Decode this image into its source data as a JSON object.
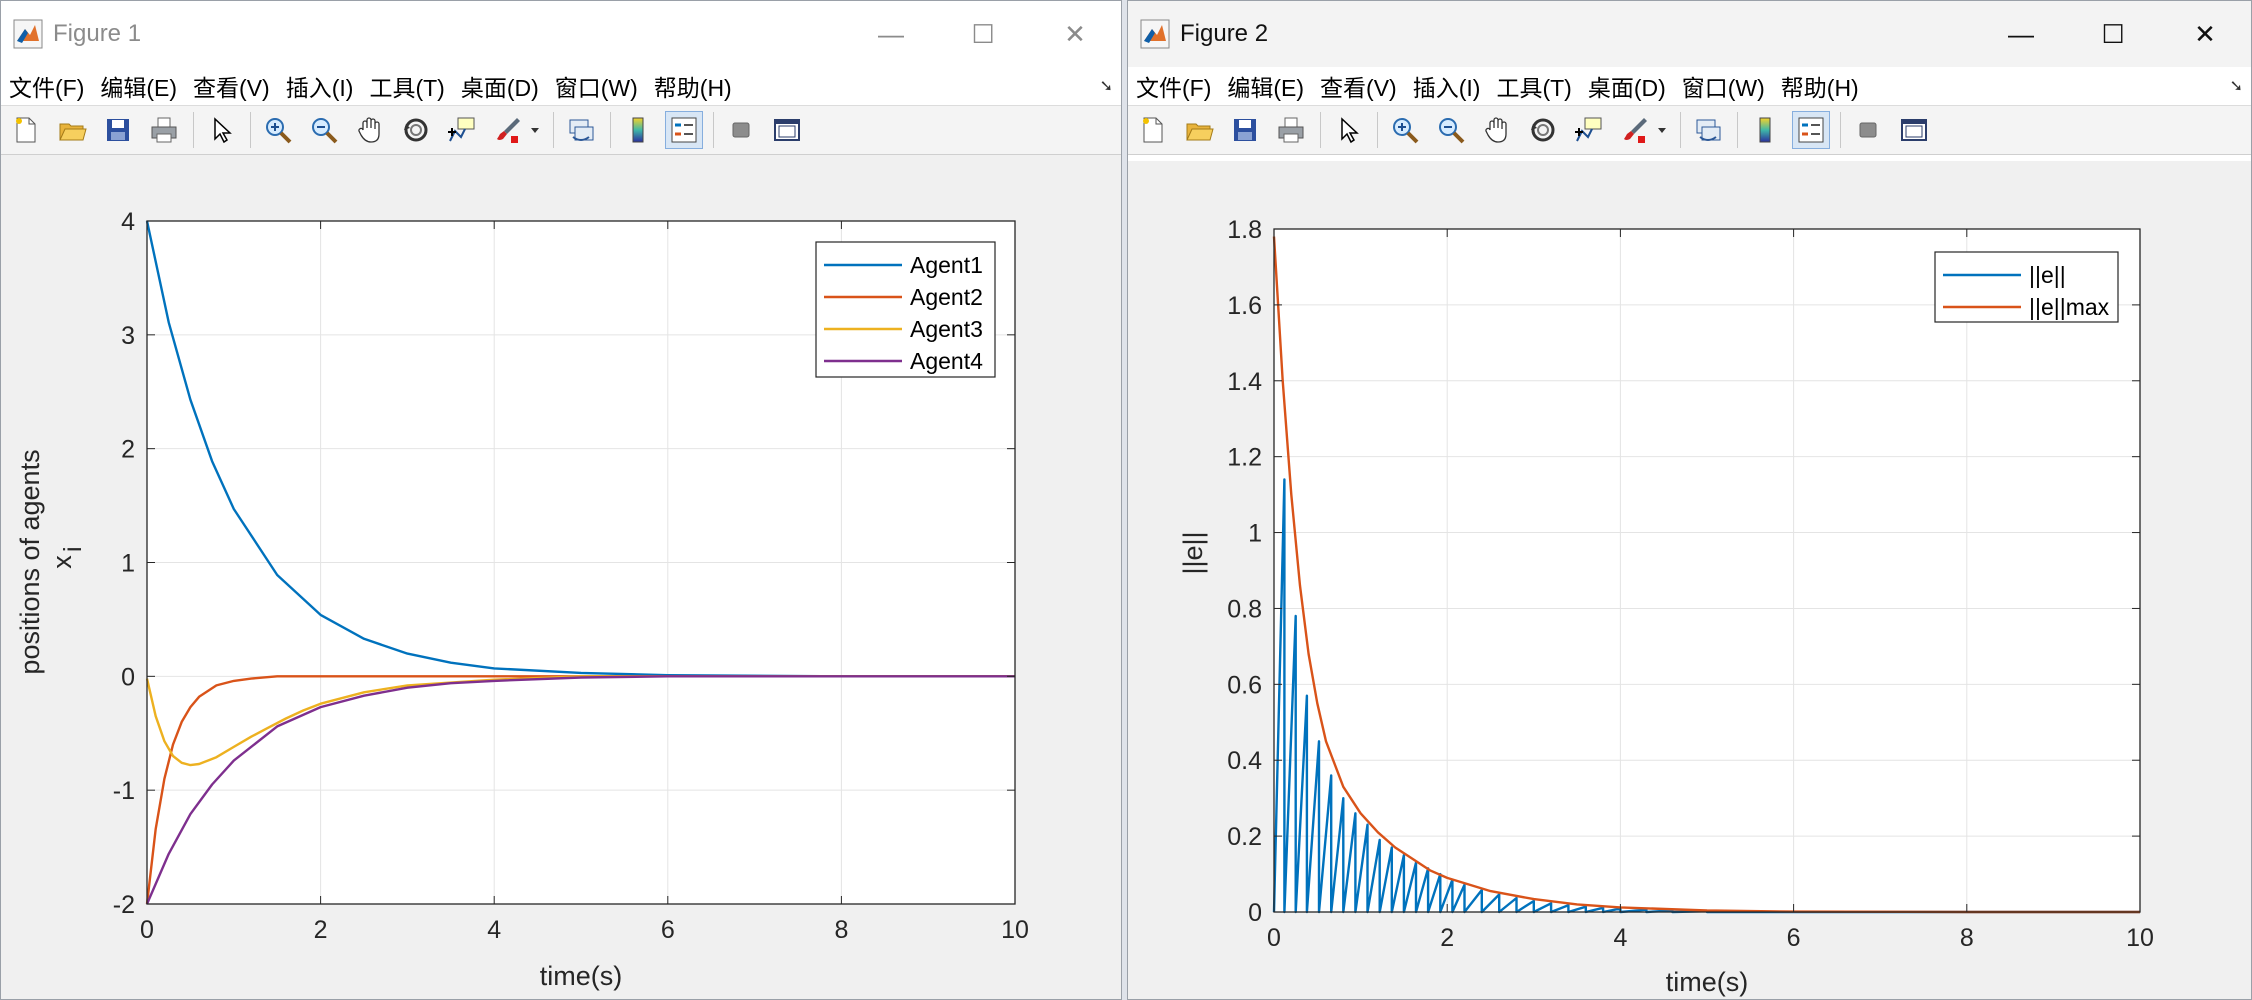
{
  "menus": [
    "文件(F)",
    "编辑(E)",
    "查看(V)",
    "插入(I)",
    "工具(T)",
    "桌面(D)",
    "窗口(W)",
    "帮助(H)"
  ],
  "window_controls": {
    "minimize": "—",
    "maximize": "☐",
    "close": "✕"
  },
  "toolbar_icons": [
    "new-figure-icon",
    "open-file-icon",
    "save-icon",
    "print-icon",
    "edit-plot-icon",
    "zoom-in-icon",
    "zoom-out-icon",
    "pan-icon",
    "rotate-3d-icon",
    "data-cursor-icon",
    "brush-icon",
    "link-plot-icon",
    "insert-colorbar-icon",
    "insert-legend-icon",
    "hide-plot-tools-icon",
    "show-plot-tools-icon"
  ],
  "figure1": {
    "title": "Figure 1",
    "chart_data": {
      "type": "line",
      "xlabel": "time(s)",
      "ylabel_line1": "positions of agents",
      "ylabel_line2": "x",
      "ylabel_sub": "i",
      "xlim": [
        0,
        10
      ],
      "ylim": [
        -2,
        4
      ],
      "xticks": [
        0,
        2,
        4,
        6,
        8,
        10
      ],
      "yticks": [
        -2,
        -1,
        0,
        1,
        2,
        3,
        4
      ],
      "grid": true,
      "legend_position": "top-right",
      "series": [
        {
          "name": "Agent1",
          "color": "#0072BD",
          "x": [
            0,
            0.25,
            0.5,
            0.75,
            1,
            1.5,
            2,
            2.5,
            3,
            3.5,
            4,
            5,
            6,
            8,
            10
          ],
          "y": [
            4,
            3.11,
            2.43,
            1.89,
            1.47,
            0.89,
            0.54,
            0.33,
            0.2,
            0.12,
            0.07,
            0.03,
            0.01,
            0,
            0
          ]
        },
        {
          "name": "Agent2",
          "color": "#D95319",
          "x": [
            0,
            0.1,
            0.2,
            0.3,
            0.4,
            0.5,
            0.6,
            0.8,
            1.0,
            1.2,
            1.5,
            2,
            10
          ],
          "y": [
            -2,
            -1.34,
            -0.9,
            -0.6,
            -0.4,
            -0.27,
            -0.18,
            -0.08,
            -0.04,
            -0.02,
            0,
            0,
            0
          ]
        },
        {
          "name": "Agent3",
          "color": "#EDB120",
          "x": [
            0,
            0.1,
            0.2,
            0.3,
            0.4,
            0.5,
            0.6,
            0.7,
            0.8,
            1.0,
            1.2,
            1.4,
            1.6,
            1.8,
            2.0,
            2.5,
            3,
            4,
            5,
            6,
            10
          ],
          "y": [
            -0.02,
            -0.35,
            -0.57,
            -0.7,
            -0.76,
            -0.78,
            -0.77,
            -0.74,
            -0.71,
            -0.62,
            -0.53,
            -0.45,
            -0.37,
            -0.3,
            -0.24,
            -0.14,
            -0.08,
            -0.03,
            0,
            0,
            0
          ]
        },
        {
          "name": "Agent4",
          "color": "#7E2F8E",
          "x": [
            0,
            0.25,
            0.5,
            0.75,
            1,
            1.5,
            2,
            2.5,
            3,
            3.5,
            4,
            5,
            6,
            8,
            10
          ],
          "y": [
            -2,
            -1.56,
            -1.21,
            -0.95,
            -0.74,
            -0.44,
            -0.27,
            -0.17,
            -0.1,
            -0.06,
            -0.04,
            -0.01,
            0,
            0,
            0
          ]
        }
      ]
    }
  },
  "figure2": {
    "title": "Figure 2",
    "chart_data": {
      "type": "line",
      "xlabel": "time(s)",
      "ylabel": "||e||",
      "xlim": [
        0,
        10
      ],
      "ylim": [
        0,
        1.8
      ],
      "xticks": [
        0,
        2,
        4,
        6,
        8,
        10
      ],
      "yticks": [
        0,
        0.2,
        0.4,
        0.6,
        0.8,
        1,
        1.2,
        1.4,
        1.6,
        1.8
      ],
      "ytick_labels": [
        "0",
        "0.2",
        "0.4",
        "0.6",
        "0.8",
        "1",
        "1.2",
        "1.4",
        "1.6",
        "1.8"
      ],
      "grid": true,
      "legend_position": "top-right",
      "series": [
        {
          "name": "||e||",
          "color": "#0072BD",
          "x": [
            0,
            0.12,
            0.12,
            0.25,
            0.25,
            0.38,
            0.38,
            0.52,
            0.52,
            0.66,
            0.66,
            0.8,
            0.8,
            0.94,
            0.94,
            1.08,
            1.08,
            1.22,
            1.22,
            1.36,
            1.36,
            1.5,
            1.5,
            1.64,
            1.64,
            1.78,
            1.78,
            1.92,
            1.92,
            2.06,
            2.06,
            2.2,
            2.2,
            2.4,
            2.4,
            2.6,
            2.6,
            2.8,
            2.8,
            3.0,
            3.0,
            3.2,
            3.2,
            3.4,
            3.4,
            3.6,
            3.6,
            3.8,
            3.8,
            4.0,
            4.0,
            4.3,
            4.3,
            4.6,
            4.6,
            5.0,
            5.0,
            10
          ],
          "y": [
            0,
            1.14,
            0,
            0.78,
            0,
            0.57,
            0,
            0.45,
            0,
            0.36,
            0,
            0.3,
            0,
            0.26,
            0,
            0.23,
            0,
            0.19,
            0,
            0.17,
            0,
            0.15,
            0,
            0.13,
            0,
            0.115,
            0,
            0.1,
            0,
            0.085,
            0,
            0.072,
            0,
            0.058,
            0,
            0.046,
            0,
            0.037,
            0,
            0.029,
            0,
            0.023,
            0,
            0.018,
            0,
            0.014,
            0,
            0.011,
            0,
            0.009,
            0,
            0.006,
            0,
            0.004,
            0,
            0.002,
            0,
            0
          ]
        },
        {
          "name": "||e||max",
          "color": "#D95319",
          "x": [
            0,
            0.1,
            0.2,
            0.3,
            0.4,
            0.5,
            0.6,
            0.8,
            1.0,
            1.2,
            1.4,
            1.6,
            1.8,
            2.0,
            2.5,
            3.0,
            3.5,
            4.0,
            5.0,
            6.0,
            8.0,
            10
          ],
          "y": [
            1.78,
            1.4,
            1.1,
            0.86,
            0.68,
            0.55,
            0.45,
            0.33,
            0.26,
            0.21,
            0.17,
            0.14,
            0.11,
            0.09,
            0.055,
            0.034,
            0.02,
            0.012,
            0.004,
            0.001,
            0,
            0
          ]
        }
      ]
    }
  }
}
